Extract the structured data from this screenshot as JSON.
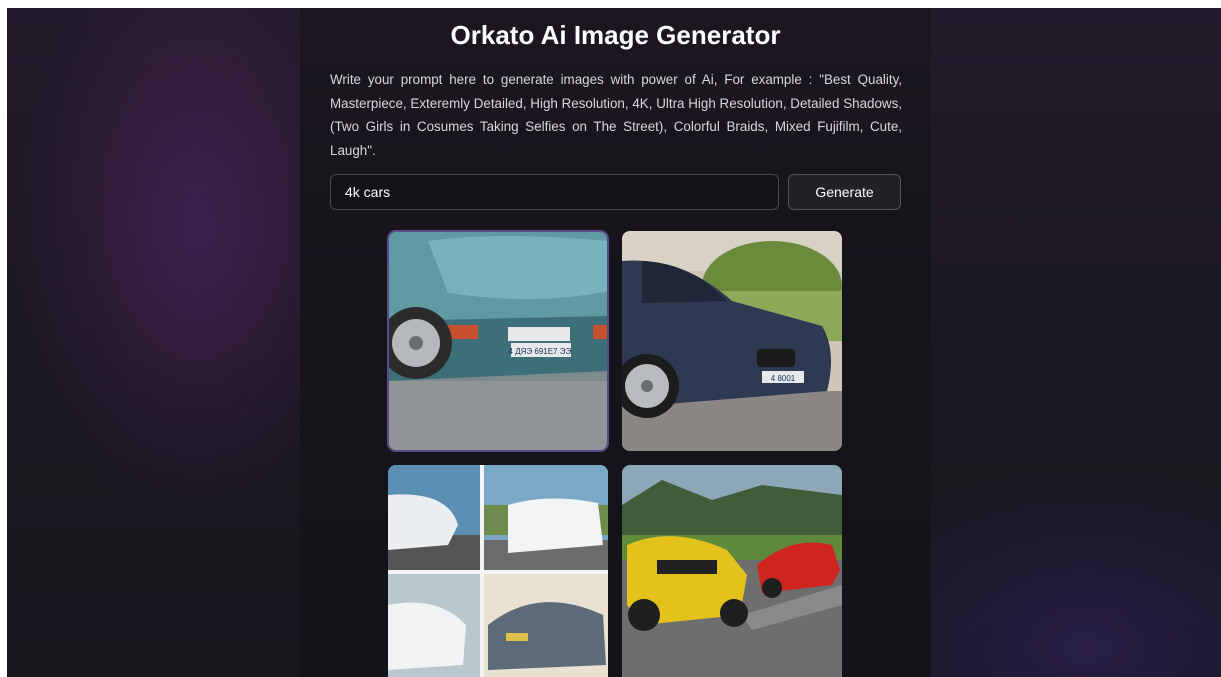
{
  "header": {
    "title": "Orkato Ai Image Generator"
  },
  "description": "Write your prompt here to generate images with power of Ai, For example : \"Best Quality, Masterpiece, Exteremly Detailed, High Resolution, 4K, Ultra High Resolution, Detailed Shadows, (Two Girls in Cosumes Taking Selfies on The Street), Colorful Braids, Mixed Fujifilm, Cute, Laugh\".",
  "prompt": {
    "value": "4k cars"
  },
  "generate_button": {
    "label": "Generate"
  },
  "results": [
    {
      "id": "teal-sports-car-closeup",
      "selected": true,
      "plate": "4 ДЯЭ 691Е7 ЭЭ."
    },
    {
      "id": "dark-blue-sedan",
      "selected": false,
      "plate": "4 8001"
    },
    {
      "id": "white-sports-car-collage",
      "selected": false
    },
    {
      "id": "yellow-and-red-cars-road",
      "selected": false
    }
  ],
  "colors": {
    "accent_outline": "#5a4a8a",
    "background": "#1a1820",
    "panel": "#16141b"
  }
}
